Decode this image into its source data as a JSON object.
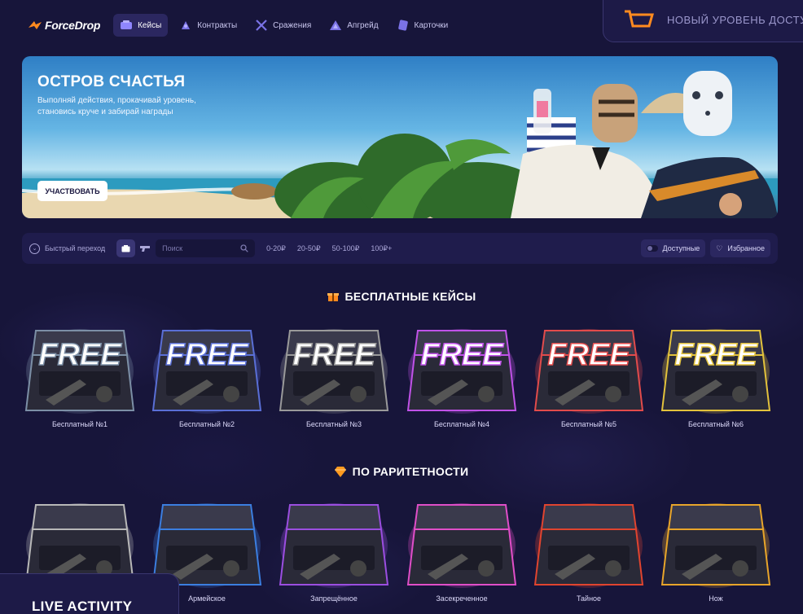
{
  "brand": {
    "name": "ForceDrop"
  },
  "nav": [
    {
      "label": "Кейсы",
      "icon": "case-icon",
      "active": true
    },
    {
      "label": "Контракты",
      "icon": "contract-icon",
      "active": false
    },
    {
      "label": "Сражения",
      "icon": "swords-icon",
      "active": false
    },
    {
      "label": "Апгрейд",
      "icon": "upgrade-icon",
      "active": false
    },
    {
      "label": "Карточки",
      "icon": "cards-icon",
      "active": false
    }
  ],
  "promo": {
    "text": "НОВЫЙ УРОВЕНЬ ДОСТУ",
    "icon": "cart-icon"
  },
  "banner": {
    "title": "ОСТРОВ СЧАСТЬЯ",
    "subtitle": "Выполняй действия, прокачивай уровень, становись круче и забирай награды",
    "button": "УЧАСТВОВАТЬ"
  },
  "filters": {
    "quick_jump": "Быстрый переход",
    "search_placeholder": "Поиск",
    "prices": [
      "0-20₽",
      "20-50₽",
      "50-100₽",
      "100₽+"
    ],
    "available": "Доступные",
    "favorites": "Избранное"
  },
  "sections": {
    "free": {
      "title": "БЕСПЛАТНЫЕ КЕЙСЫ",
      "icon": "gift-icon"
    },
    "rarity": {
      "title": "ПО РАРИТЕТНОСТИ",
      "icon": "diamond-icon"
    }
  },
  "free_cases": [
    {
      "label": "Бесплатный №1",
      "art_text": "FREE",
      "color": "#7c8fa6"
    },
    {
      "label": "Бесплатный №2",
      "art_text": "FREE",
      "color": "#5a6fd6"
    },
    {
      "label": "Бесплатный №3",
      "art_text": "FREE",
      "color": "#9a9a9a"
    },
    {
      "label": "Бесплатный №4",
      "art_text": "FREE",
      "color": "#c052e8"
    },
    {
      "label": "Бесплатный №5",
      "art_text": "FREE",
      "color": "#e24b4b"
    },
    {
      "label": "Бесплатный №6",
      "art_text": "FREE",
      "color": "#e2c23c"
    }
  ],
  "rarity_cases": [
    {
      "label": "",
      "color": "#b8b8b8"
    },
    {
      "label": "Армейское",
      "color": "#3b7ee0"
    },
    {
      "label": "Запрещённое",
      "color": "#9b4ee0"
    },
    {
      "label": "Засекреченное",
      "color": "#e04ec8"
    },
    {
      "label": "Тайное",
      "color": "#e0442f"
    },
    {
      "label": "Нож",
      "color": "#e8a52a"
    }
  ],
  "live_activity": {
    "title": "LIVE ACTIVITY"
  }
}
